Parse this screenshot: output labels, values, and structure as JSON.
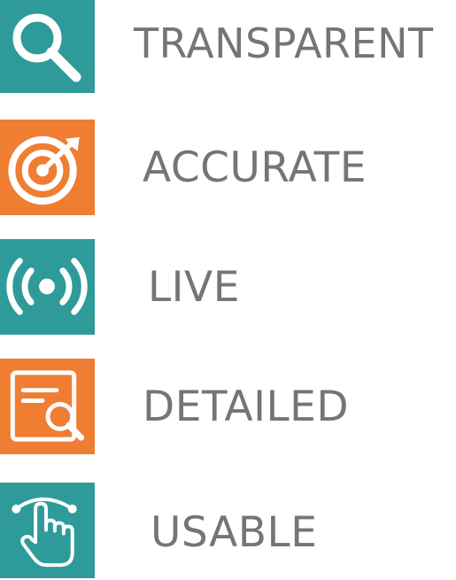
{
  "colors": {
    "teal": "#2e9b9a",
    "orange": "#ef7d32",
    "text": "#757575",
    "icon": "#ffffff"
  },
  "features": [
    {
      "label": "TRANSPARENT",
      "icon": "magnifying-glass-icon",
      "tile_color": "teal"
    },
    {
      "label": "ACCURATE",
      "icon": "target-icon",
      "tile_color": "orange"
    },
    {
      "label": "LIVE",
      "icon": "broadcast-icon",
      "tile_color": "teal"
    },
    {
      "label": "DETAILED",
      "icon": "document-search-icon",
      "tile_color": "orange"
    },
    {
      "label": "USABLE",
      "icon": "touch-hand-icon",
      "tile_color": "teal"
    }
  ]
}
